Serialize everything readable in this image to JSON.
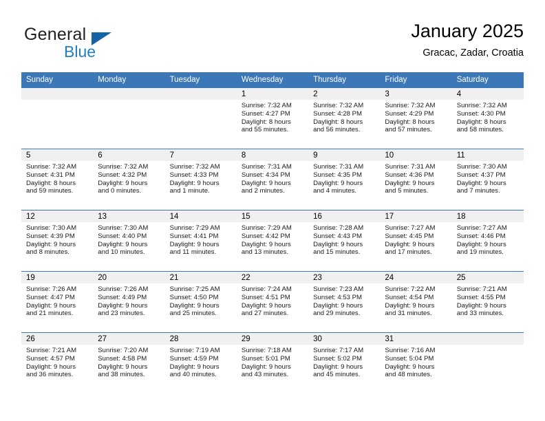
{
  "brand": {
    "word_one": "General",
    "word_two": "Blue",
    "triangle_icon": "brand-triangle-icon",
    "colors": {
      "blue": "#1f7fc4",
      "triangle": "#1464a5",
      "dark": "#231f20"
    }
  },
  "header": {
    "title": "January 2025",
    "subtitle": "Gracac, Zadar, Croatia"
  },
  "theme": {
    "header_bg": "#3c77b8",
    "header_text": "#ffffff",
    "daynum_band_bg": "#f0f0f0",
    "grid_line": "#3c77b8"
  },
  "weekdays": [
    "Sunday",
    "Monday",
    "Tuesday",
    "Wednesday",
    "Thursday",
    "Friday",
    "Saturday"
  ],
  "weeks": [
    [
      {
        "day": "",
        "lines": []
      },
      {
        "day": "",
        "lines": []
      },
      {
        "day": "",
        "lines": []
      },
      {
        "day": "1",
        "lines": [
          "Sunrise: 7:32 AM",
          "Sunset: 4:27 PM",
          "Daylight: 8 hours",
          "and 55 minutes."
        ]
      },
      {
        "day": "2",
        "lines": [
          "Sunrise: 7:32 AM",
          "Sunset: 4:28 PM",
          "Daylight: 8 hours",
          "and 56 minutes."
        ]
      },
      {
        "day": "3",
        "lines": [
          "Sunrise: 7:32 AM",
          "Sunset: 4:29 PM",
          "Daylight: 8 hours",
          "and 57 minutes."
        ]
      },
      {
        "day": "4",
        "lines": [
          "Sunrise: 7:32 AM",
          "Sunset: 4:30 PM",
          "Daylight: 8 hours",
          "and 58 minutes."
        ]
      }
    ],
    [
      {
        "day": "5",
        "lines": [
          "Sunrise: 7:32 AM",
          "Sunset: 4:31 PM",
          "Daylight: 8 hours",
          "and 59 minutes."
        ]
      },
      {
        "day": "6",
        "lines": [
          "Sunrise: 7:32 AM",
          "Sunset: 4:32 PM",
          "Daylight: 9 hours",
          "and 0 minutes."
        ]
      },
      {
        "day": "7",
        "lines": [
          "Sunrise: 7:32 AM",
          "Sunset: 4:33 PM",
          "Daylight: 9 hours",
          "and 1 minute."
        ]
      },
      {
        "day": "8",
        "lines": [
          "Sunrise: 7:31 AM",
          "Sunset: 4:34 PM",
          "Daylight: 9 hours",
          "and 2 minutes."
        ]
      },
      {
        "day": "9",
        "lines": [
          "Sunrise: 7:31 AM",
          "Sunset: 4:35 PM",
          "Daylight: 9 hours",
          "and 4 minutes."
        ]
      },
      {
        "day": "10",
        "lines": [
          "Sunrise: 7:31 AM",
          "Sunset: 4:36 PM",
          "Daylight: 9 hours",
          "and 5 minutes."
        ]
      },
      {
        "day": "11",
        "lines": [
          "Sunrise: 7:30 AM",
          "Sunset: 4:37 PM",
          "Daylight: 9 hours",
          "and 7 minutes."
        ]
      }
    ],
    [
      {
        "day": "12",
        "lines": [
          "Sunrise: 7:30 AM",
          "Sunset: 4:39 PM",
          "Daylight: 9 hours",
          "and 8 minutes."
        ]
      },
      {
        "day": "13",
        "lines": [
          "Sunrise: 7:30 AM",
          "Sunset: 4:40 PM",
          "Daylight: 9 hours",
          "and 10 minutes."
        ]
      },
      {
        "day": "14",
        "lines": [
          "Sunrise: 7:29 AM",
          "Sunset: 4:41 PM",
          "Daylight: 9 hours",
          "and 11 minutes."
        ]
      },
      {
        "day": "15",
        "lines": [
          "Sunrise: 7:29 AM",
          "Sunset: 4:42 PM",
          "Daylight: 9 hours",
          "and 13 minutes."
        ]
      },
      {
        "day": "16",
        "lines": [
          "Sunrise: 7:28 AM",
          "Sunset: 4:43 PM",
          "Daylight: 9 hours",
          "and 15 minutes."
        ]
      },
      {
        "day": "17",
        "lines": [
          "Sunrise: 7:27 AM",
          "Sunset: 4:45 PM",
          "Daylight: 9 hours",
          "and 17 minutes."
        ]
      },
      {
        "day": "18",
        "lines": [
          "Sunrise: 7:27 AM",
          "Sunset: 4:46 PM",
          "Daylight: 9 hours",
          "and 19 minutes."
        ]
      }
    ],
    [
      {
        "day": "19",
        "lines": [
          "Sunrise: 7:26 AM",
          "Sunset: 4:47 PM",
          "Daylight: 9 hours",
          "and 21 minutes."
        ]
      },
      {
        "day": "20",
        "lines": [
          "Sunrise: 7:26 AM",
          "Sunset: 4:49 PM",
          "Daylight: 9 hours",
          "and 23 minutes."
        ]
      },
      {
        "day": "21",
        "lines": [
          "Sunrise: 7:25 AM",
          "Sunset: 4:50 PM",
          "Daylight: 9 hours",
          "and 25 minutes."
        ]
      },
      {
        "day": "22",
        "lines": [
          "Sunrise: 7:24 AM",
          "Sunset: 4:51 PM",
          "Daylight: 9 hours",
          "and 27 minutes."
        ]
      },
      {
        "day": "23",
        "lines": [
          "Sunrise: 7:23 AM",
          "Sunset: 4:53 PM",
          "Daylight: 9 hours",
          "and 29 minutes."
        ]
      },
      {
        "day": "24",
        "lines": [
          "Sunrise: 7:22 AM",
          "Sunset: 4:54 PM",
          "Daylight: 9 hours",
          "and 31 minutes."
        ]
      },
      {
        "day": "25",
        "lines": [
          "Sunrise: 7:21 AM",
          "Sunset: 4:55 PM",
          "Daylight: 9 hours",
          "and 33 minutes."
        ]
      }
    ],
    [
      {
        "day": "26",
        "lines": [
          "Sunrise: 7:21 AM",
          "Sunset: 4:57 PM",
          "Daylight: 9 hours",
          "and 36 minutes."
        ]
      },
      {
        "day": "27",
        "lines": [
          "Sunrise: 7:20 AM",
          "Sunset: 4:58 PM",
          "Daylight: 9 hours",
          "and 38 minutes."
        ]
      },
      {
        "day": "28",
        "lines": [
          "Sunrise: 7:19 AM",
          "Sunset: 4:59 PM",
          "Daylight: 9 hours",
          "and 40 minutes."
        ]
      },
      {
        "day": "29",
        "lines": [
          "Sunrise: 7:18 AM",
          "Sunset: 5:01 PM",
          "Daylight: 9 hours",
          "and 43 minutes."
        ]
      },
      {
        "day": "30",
        "lines": [
          "Sunrise: 7:17 AM",
          "Sunset: 5:02 PM",
          "Daylight: 9 hours",
          "and 45 minutes."
        ]
      },
      {
        "day": "31",
        "lines": [
          "Sunrise: 7:16 AM",
          "Sunset: 5:04 PM",
          "Daylight: 9 hours",
          "and 48 minutes."
        ]
      },
      {
        "day": "",
        "lines": []
      }
    ]
  ]
}
